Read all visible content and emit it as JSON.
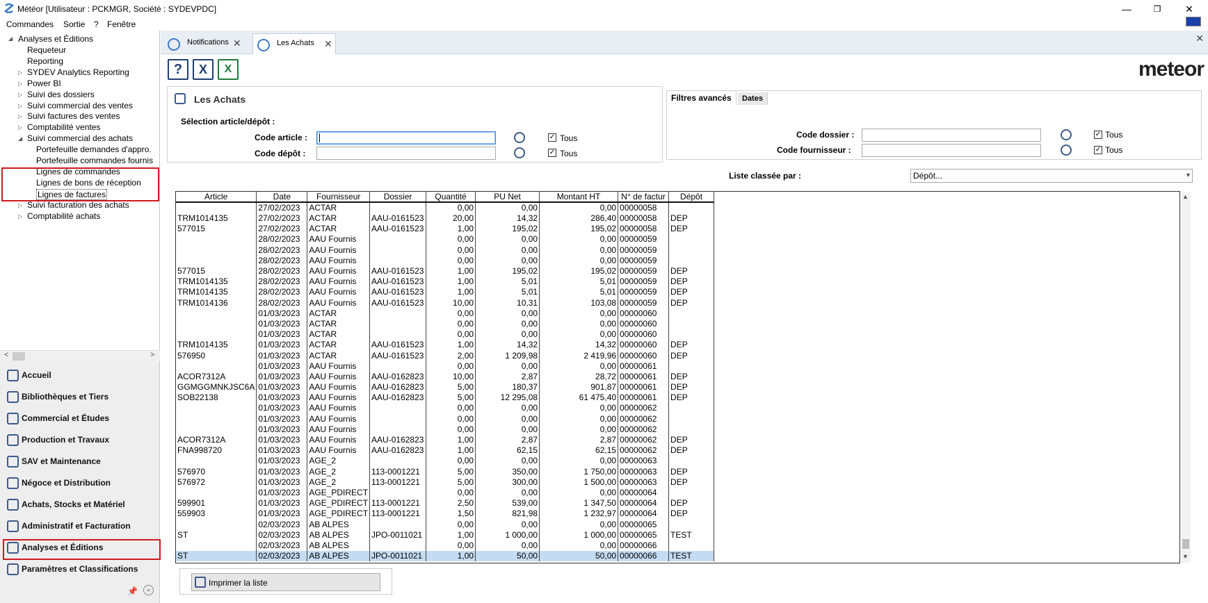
{
  "window": {
    "title": "Météor [Utilisateur : PCKMGR, Société : SYDEVPDC]",
    "minimize": "—",
    "restore": "❐",
    "close": "✕"
  },
  "menu": [
    "Commandes",
    "Sortie",
    "?",
    "Fenêtre"
  ],
  "tree": {
    "root": "Analyses et Éditions",
    "items": [
      {
        "label": "Requeteur",
        "level": 1,
        "expander": ""
      },
      {
        "label": "Reporting",
        "level": 1,
        "expander": ""
      },
      {
        "label": "SYDEV Analytics Reporting",
        "level": 1,
        "expander": "▷"
      },
      {
        "label": "Power BI",
        "level": 1,
        "expander": "▷"
      },
      {
        "label": "Suivi des dossiers",
        "level": 1,
        "expander": "▷"
      },
      {
        "label": "Suivi commercial des ventes",
        "level": 1,
        "expander": "▷"
      },
      {
        "label": "Suivi factures des ventes",
        "level": 1,
        "expander": "▷"
      },
      {
        "label": "Comptabilité ventes",
        "level": 1,
        "expander": "▷"
      },
      {
        "label": "Suivi commercial des achats",
        "level": 1,
        "expander": "◢"
      },
      {
        "label": "Portefeuille demandes d'appro.",
        "level": 2,
        "expander": ""
      },
      {
        "label": "Portefeuille commandes fournis",
        "level": 2,
        "expander": ""
      },
      {
        "label": "Lignes de commandes",
        "level": 2,
        "expander": ""
      },
      {
        "label": "Lignes de bons de réception",
        "level": 2,
        "expander": ""
      },
      {
        "label": "Lignes de factures",
        "level": 2,
        "expander": ""
      },
      {
        "label": "Suivi facturation des achats",
        "level": 1,
        "expander": "▷"
      },
      {
        "label": "Comptabilité achats",
        "level": 1,
        "expander": "▷"
      }
    ]
  },
  "nav": [
    "Accueil",
    "Bibliothèques et Tiers",
    "Commercial et Études",
    "Production et Travaux",
    "SAV et Maintenance",
    "Négoce et Distribution",
    "Achats, Stocks et Matériel",
    "Administratif et Facturation",
    "Analyses et Éditions",
    "Paramètres et Classifications"
  ],
  "tabs": [
    {
      "label": "Notifications"
    },
    {
      "label": "Les Achats"
    }
  ],
  "toolbar": {
    "help": "?",
    "close": "X",
    "excel": "X"
  },
  "logo": "meteor",
  "panel": {
    "title": "Les Achats",
    "selection_label": "Sélection article/dépôt :",
    "code_article_label": "Code article :",
    "code_depot_label": "Code dépôt :",
    "tous": "Tous",
    "sorted_label": "Liste classée par :",
    "sorted_value": "Dépôt..."
  },
  "filters": {
    "tab_advanced": "Filtres avancés",
    "tab_dates": "Dates",
    "code_dossier_label": "Code dossier :",
    "code_fournisseur_label": "Code fournisseur :",
    "tous": "Tous"
  },
  "grid": {
    "columns": [
      "Article",
      "Date",
      "Fournisseur",
      "Dossier",
      "Quantité",
      "PU Net",
      "Montant HT",
      "N° de factur",
      "Dépôt"
    ],
    "rows": [
      [
        "",
        "27/02/2023",
        "ACTAR",
        "",
        "0,00",
        "0,00",
        "0,00",
        "00000058",
        ""
      ],
      [
        "TRM1014135",
        "27/02/2023",
        "ACTAR",
        "AAU-0161523",
        "20,00",
        "14,32",
        "286,40",
        "00000058",
        "DEP"
      ],
      [
        "577015",
        "27/02/2023",
        "ACTAR",
        "AAU-0161523",
        "1,00",
        "195,02",
        "195,02",
        "00000058",
        "DEP"
      ],
      [
        "",
        "28/02/2023",
        "AAU Fournis",
        "",
        "0,00",
        "0,00",
        "0,00",
        "00000059",
        ""
      ],
      [
        "",
        "28/02/2023",
        "AAU Fournis",
        "",
        "0,00",
        "0,00",
        "0,00",
        "00000059",
        ""
      ],
      [
        "",
        "28/02/2023",
        "AAU Fournis",
        "",
        "0,00",
        "0,00",
        "0,00",
        "00000059",
        ""
      ],
      [
        "577015",
        "28/02/2023",
        "AAU Fournis",
        "AAU-0161523",
        "1,00",
        "195,02",
        "195,02",
        "00000059",
        "DEP"
      ],
      [
        "TRM1014135",
        "28/02/2023",
        "AAU Fournis",
        "AAU-0161523",
        "1,00",
        "5,01",
        "5,01",
        "00000059",
        "DEP"
      ],
      [
        "TRM1014135",
        "28/02/2023",
        "AAU Fournis",
        "AAU-0161523",
        "1,00",
        "5,01",
        "5,01",
        "00000059",
        "DEP"
      ],
      [
        "TRM1014136",
        "28/02/2023",
        "AAU Fournis",
        "AAU-0161523",
        "10,00",
        "10,31",
        "103,08",
        "00000059",
        "DEP"
      ],
      [
        "",
        "01/03/2023",
        "ACTAR",
        "",
        "0,00",
        "0,00",
        "0,00",
        "00000060",
        ""
      ],
      [
        "",
        "01/03/2023",
        "ACTAR",
        "",
        "0,00",
        "0,00",
        "0,00",
        "00000060",
        ""
      ],
      [
        "",
        "01/03/2023",
        "ACTAR",
        "",
        "0,00",
        "0,00",
        "0,00",
        "00000060",
        ""
      ],
      [
        "TRM1014135",
        "01/03/2023",
        "ACTAR",
        "AAU-0161523",
        "1,00",
        "14,32",
        "14,32",
        "00000060",
        "DEP"
      ],
      [
        "576950",
        "01/03/2023",
        "ACTAR",
        "AAU-0161523",
        "2,00",
        "1 209,98",
        "2 419,96",
        "00000060",
        "DEP"
      ],
      [
        "",
        "01/03/2023",
        "AAU Fournis",
        "",
        "0,00",
        "0,00",
        "0,00",
        "00000061",
        ""
      ],
      [
        "ACOR7312A",
        "01/03/2023",
        "AAU Fournis",
        "AAU-0162823",
        "10,00",
        "2,87",
        "28,72",
        "00000061",
        "DEP"
      ],
      [
        "GGMGGMNKJSC6A",
        "01/03/2023",
        "AAU Fournis",
        "AAU-0162823",
        "5,00",
        "180,37",
        "901,87",
        "00000061",
        "DEP"
      ],
      [
        "SOB22138",
        "01/03/2023",
        "AAU Fournis",
        "AAU-0162823",
        "5,00",
        "12 295,08",
        "61 475,40",
        "00000061",
        "DEP"
      ],
      [
        "",
        "01/03/2023",
        "AAU Fournis",
        "",
        "0,00",
        "0,00",
        "0,00",
        "00000062",
        ""
      ],
      [
        "",
        "01/03/2023",
        "AAU Fournis",
        "",
        "0,00",
        "0,00",
        "0,00",
        "00000062",
        ""
      ],
      [
        "",
        "01/03/2023",
        "AAU Fournis",
        "",
        "0,00",
        "0,00",
        "0,00",
        "00000062",
        ""
      ],
      [
        "ACOR7312A",
        "01/03/2023",
        "AAU Fournis",
        "AAU-0162823",
        "1,00",
        "2,87",
        "2,87",
        "00000062",
        "DEP"
      ],
      [
        "FNA998720",
        "01/03/2023",
        "AAU Fournis",
        "AAU-0162823",
        "1,00",
        "62,15",
        "62,15",
        "00000062",
        "DEP"
      ],
      [
        "",
        "01/03/2023",
        "AGE_2",
        "",
        "0,00",
        "0,00",
        "0,00",
        "00000063",
        ""
      ],
      [
        "576970",
        "01/03/2023",
        "AGE_2",
        "113-0001221",
        "5,00",
        "350,00",
        "1 750,00",
        "00000063",
        "DEP"
      ],
      [
        "576972",
        "01/03/2023",
        "AGE_2",
        "113-0001221",
        "5,00",
        "300,00",
        "1 500,00",
        "00000063",
        "DEP"
      ],
      [
        "",
        "01/03/2023",
        "AGE_PDIRECT",
        "",
        "0,00",
        "0,00",
        "0,00",
        "00000064",
        ""
      ],
      [
        "599901",
        "01/03/2023",
        "AGE_PDIRECT",
        "113-0001221",
        "2,50",
        "539,00",
        "1 347,50",
        "00000064",
        "DEP"
      ],
      [
        "559903",
        "01/03/2023",
        "AGE_PDIRECT",
        "113-0001221",
        "1,50",
        "821,98",
        "1 232,97",
        "00000064",
        "DEP"
      ],
      [
        "",
        "02/03/2023",
        "AB ALPES",
        "",
        "0,00",
        "0,00",
        "0,00",
        "00000065",
        ""
      ],
      [
        "ST",
        "02/03/2023",
        "AB ALPES",
        "JPO-0011021",
        "1,00",
        "1 000,00",
        "1 000,00",
        "00000065",
        "TEST"
      ],
      [
        "",
        "02/03/2023",
        "AB ALPES",
        "",
        "0,00",
        "0,00",
        "0,00",
        "00000066",
        ""
      ],
      [
        "ST",
        "02/03/2023",
        "AB ALPES",
        "JPO-0011021",
        "1,00",
        "50,00",
        "50,00",
        "00000066",
        "TEST"
      ]
    ]
  },
  "print_button": "Imprimer la liste",
  "colors": {
    "accent": "#3a7bc8",
    "highlight_red": "#d0181f",
    "selected_row": "#c4dbf2"
  }
}
